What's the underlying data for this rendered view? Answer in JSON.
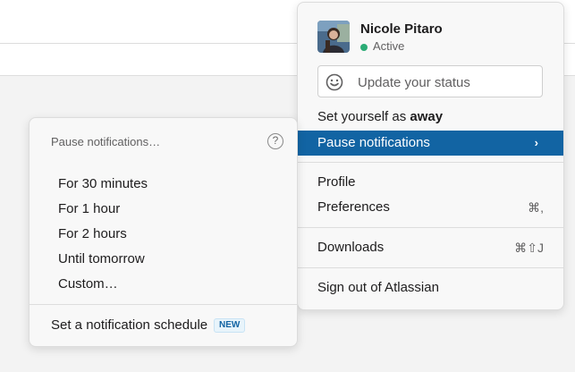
{
  "user": {
    "name": "Nicole Pitaro",
    "presence": "Active",
    "presence_color": "#2bac76"
  },
  "status": {
    "placeholder": "Update your status",
    "icon": "smile-icon"
  },
  "menu": {
    "set_away_prefix": "Set yourself as ",
    "set_away_strong": "away",
    "pause_notifications": "Pause notifications",
    "pause_chevron": "›",
    "profile": "Profile",
    "preferences": "Preferences",
    "preferences_shortcut": "⌘,",
    "downloads": "Downloads",
    "downloads_shortcut": "⌘⇧J",
    "sign_out": "Sign out of Atlassian",
    "highlight_color": "#1264a3"
  },
  "submenu": {
    "title": "Pause notifications…",
    "help_glyph": "?",
    "options": [
      "For 30 minutes",
      "For 1 hour",
      "For 2 hours",
      "Until tomorrow",
      "Custom…"
    ],
    "schedule": "Set a notification schedule",
    "badge": "NEW"
  }
}
